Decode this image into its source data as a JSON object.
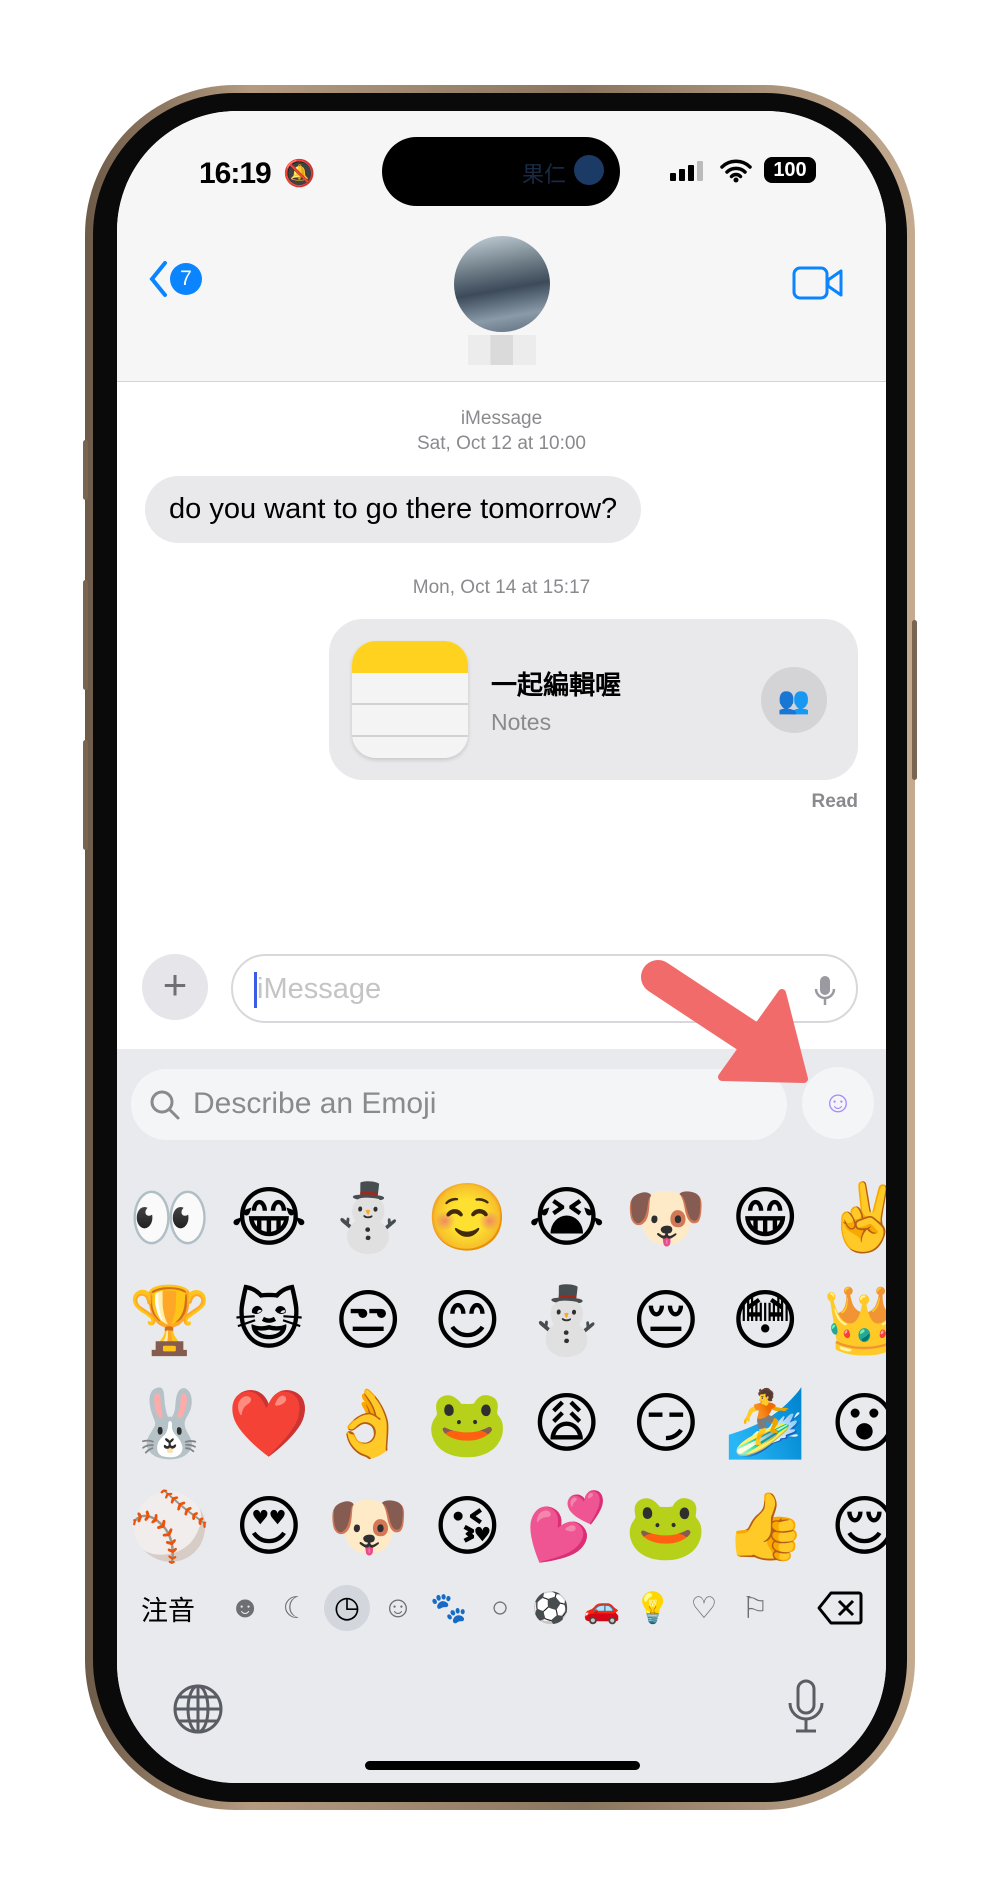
{
  "status": {
    "time": "16:19",
    "battery": "100",
    "island_text": "果仁"
  },
  "nav": {
    "back_badge": "7"
  },
  "chat": {
    "service_label": "iMessage",
    "date1": "Sat, Oct 12 at 10:00",
    "incoming_message": "do you want to go there tomorrow?",
    "date2": "Mon, Oct 14 at 15:17",
    "shared_note_title": "一起編輯喔",
    "shared_note_app": "Notes",
    "read_receipt": "Read"
  },
  "input": {
    "placeholder": "iMessage"
  },
  "emoji_keyboard": {
    "search_placeholder": "Describe an Emoji",
    "rows": [
      [
        "👀",
        "😂",
        "⛄",
        "☺️",
        "😭",
        "🐶",
        "😁",
        "✌️"
      ],
      [
        "🏆",
        "😺",
        "😒",
        "😊",
        "⛄",
        "😔",
        "😳",
        "👑"
      ],
      [
        "🐰",
        "❤️",
        "👌",
        "🐸",
        "😩",
        "😏",
        "🏄",
        "😮"
      ],
      [
        "⚾",
        "😍",
        "🐶",
        "😘",
        "💕",
        "🐸",
        "👍",
        "😌"
      ]
    ],
    "mode_label": "注音",
    "categories": [
      "memoji-icon",
      "sticker-icon",
      "recent-clock-icon",
      "smileys-icon",
      "animals-icon",
      "food-apple-icon",
      "activity-ball-icon",
      "travel-car-icon",
      "objects-bulb-icon",
      "symbols-heart-icon",
      "flags-icon"
    ],
    "selected_category": "recent-clock-icon"
  },
  "colors": {
    "accent": "#0a84ff",
    "keyboard_bg": "#e8eaee",
    "annotation_arrow": "#f26b6b"
  }
}
